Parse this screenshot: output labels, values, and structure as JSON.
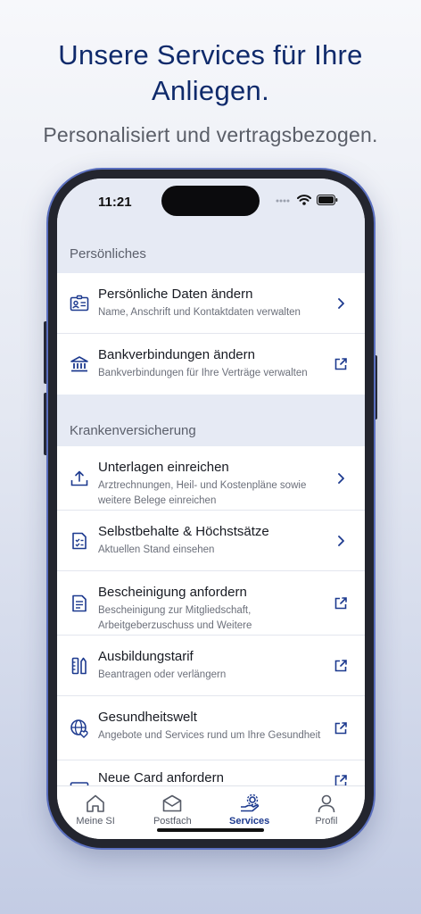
{
  "headline": "Unsere Services für Ihre Anliegen.",
  "subline": "Personalisiert und vertragsbezogen.",
  "status": {
    "time": "11:21"
  },
  "sections": [
    {
      "title": "Persönliches",
      "items": [
        {
          "icon": "id-card-icon",
          "title": "Persönliche Daten ändern",
          "desc": "Name, Anschrift und Kontaktdaten verwalten",
          "action": "chevron-right-icon"
        },
        {
          "icon": "bank-icon",
          "title": "Bankverbindungen ändern",
          "desc": "Bankverbindungen für Ihre Verträge verwalten",
          "action": "external-link-icon"
        }
      ]
    },
    {
      "title": "Krankenversicherung",
      "items": [
        {
          "icon": "upload-icon",
          "title": "Unterlagen einreichen",
          "desc": "Arztrechnungen, Heil- und Kostenpläne sowie weitere Belege einreichen",
          "action": "chevron-right-icon"
        },
        {
          "icon": "checklist-icon",
          "title": "Selbstbehalte & Höchstsätze",
          "desc": "Aktuellen Stand einsehen",
          "action": "chevron-right-icon"
        },
        {
          "icon": "document-icon",
          "title": "Bescheinigung anfordern",
          "desc": "Bescheinigung zur Mitgliedschaft, Arbeitgeberzuschuss und Weitere",
          "action": "external-link-icon"
        },
        {
          "icon": "ruler-pencil-icon",
          "title": "Ausbildungstarif",
          "desc": "Beantragen oder verlängern",
          "action": "external-link-icon"
        },
        {
          "icon": "globe-heart-icon",
          "title": "Gesundheitswelt",
          "desc": "Angebote und Services rund um Ihre Gesundheit",
          "action": "external-link-icon"
        },
        {
          "icon": "card-icon",
          "title": "Neue Card anfordern",
          "desc": "",
          "action": "external-link-icon"
        }
      ]
    }
  ],
  "tabs": [
    {
      "label": "Meine SI",
      "icon": "home-icon"
    },
    {
      "label": "Postfach",
      "icon": "mail-icon"
    },
    {
      "label": "Services",
      "icon": "services-gear-icon",
      "active": true
    },
    {
      "label": "Profil",
      "icon": "person-icon"
    }
  ],
  "colors": {
    "accent": "#1d3a8f",
    "headline": "#0f2a6b",
    "section_bg": "#e6eaf4"
  }
}
